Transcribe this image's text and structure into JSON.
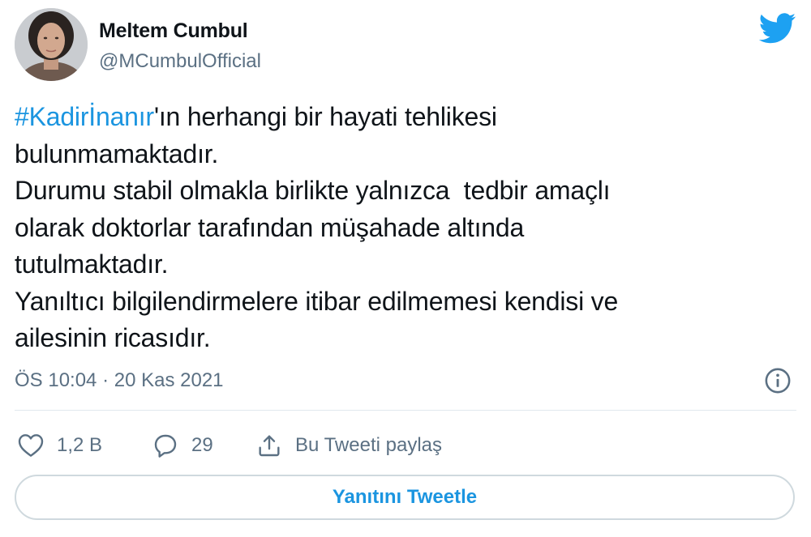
{
  "author": {
    "name": "Meltem Cumbul",
    "handle": "@MCumbulOfficial",
    "avatar_icon": "profile-photo"
  },
  "brand": {
    "icon": "twitter-bird-icon",
    "color": "#1da1f2"
  },
  "tweet": {
    "hashtag": "#Kadirİnanır",
    "lines": [
      "'ın herhangi bir hayati tehlikesi",
      "bulunmamaktadır.",
      "Durumu stabil olmakla birlikte yalnızca  tedbir amaçlı",
      "olarak doktorlar tarafından müşahade altında",
      "tutulmaktadır.",
      "Yanıltıcı bilgilendirmelere itibar edilmemesi kendisi ve",
      "ailesinin ricasıdır."
    ],
    "timestamp": "ÖS 10:04 · 20 Kas 2021",
    "info_icon": "info-icon"
  },
  "actions": {
    "likes": "1,2 B",
    "replies": "29",
    "share_label": "Bu Tweeti paylaş"
  },
  "reply_button": {
    "label": "Yanıtını Tweetle"
  },
  "colors": {
    "link": "#1b95e0",
    "secondary_text": "#5b7083",
    "border": "#cfd9de"
  }
}
